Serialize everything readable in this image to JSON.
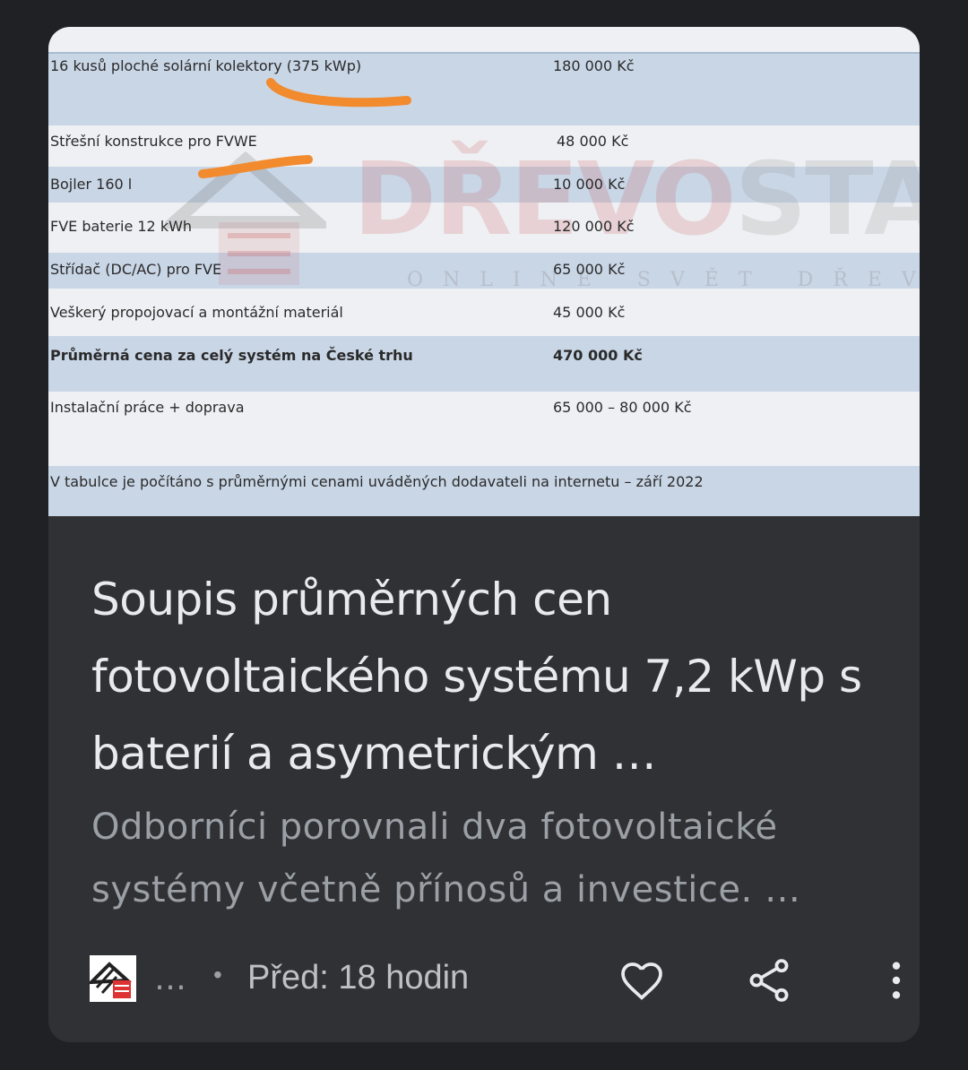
{
  "thumbnail": {
    "rows": [
      {
        "label": "16 kusů ploché solární kolektory (375 kWp)",
        "value": "180 000 Kč"
      },
      {
        "label": "Střešní konstrukce pro FVWE",
        "value": "48 000 Kč"
      },
      {
        "label": "Bojler 160 l",
        "value": "10 000 Kč"
      },
      {
        "label": "FVE baterie 12 kWh",
        "value": "120 000 Kč"
      },
      {
        "label": "Střídač (DC/AC) pro FVE",
        "value": "65 000 Kč"
      },
      {
        "label": "Veškerý propojovací a montážní materiál",
        "value": "45 000 Kč"
      },
      {
        "label": "Průměrná cena za celý systém na České trhu",
        "value": "470 000 Kč"
      },
      {
        "label": "Instalační práce + doprava",
        "value": "65 000 – 80 000 Kč"
      }
    ],
    "footnote": "V tabulce je počítáno s průměrnými cenami uváděných dodavateli na internetu – září 2022",
    "watermark": {
      "main_red": "DŘEVO",
      "main_gray": "STAVITE",
      "sub": "ONLINE SVĚT DŘEVOSTAVI"
    },
    "marker_color": "#f28a2e"
  },
  "article": {
    "title": "Soupis průměrných cen fotovoltaického systému 7,2 kWp s baterií a asymetrickým …",
    "description": "Odborníci porovnali dva fotovoltaické systémy včetně přínosů a investice. …"
  },
  "footer": {
    "source": "…",
    "separator": "•",
    "time": "Před: 18 hodin",
    "icons": [
      "like-icon",
      "share-icon",
      "more-vert-icon"
    ]
  },
  "colors": {
    "background": "#202124",
    "card": "#303134",
    "title": "#e8eaed",
    "description": "#9aa0a6"
  }
}
